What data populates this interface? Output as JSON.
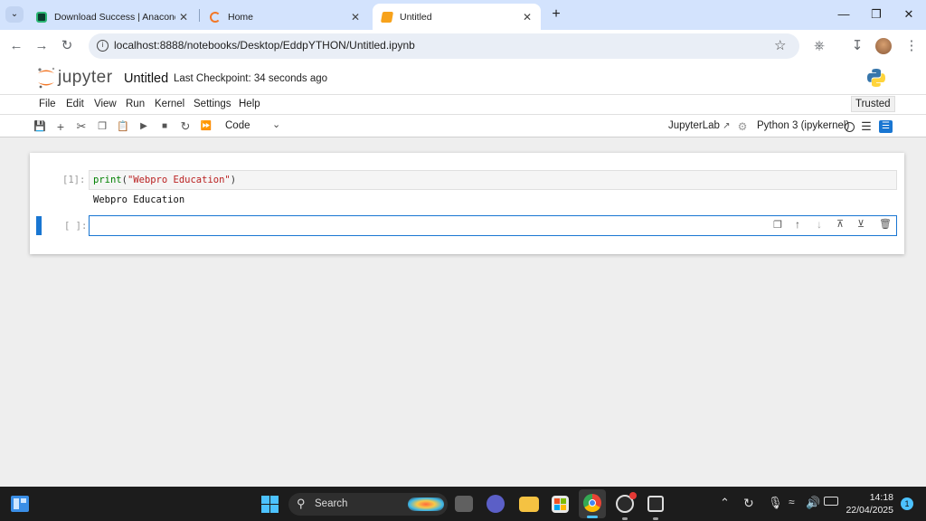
{
  "browser": {
    "tabs": [
      {
        "title": "Download Success | Anaconda",
        "active": false
      },
      {
        "title": "Home",
        "active": false
      },
      {
        "title": "Untitled",
        "active": true
      }
    ],
    "url": "localhost:8888/notebooks/Desktop/EddpYTHON/Untitled.ipynb"
  },
  "jupyter": {
    "logo_text": "jupyter",
    "notebook_title": "Untitled",
    "checkpoint": "Last Checkpoint: 34 seconds ago",
    "menu": [
      "File",
      "Edit",
      "View",
      "Run",
      "Kernel",
      "Settings",
      "Help"
    ],
    "trusted": "Trusted",
    "cell_type": "Code",
    "jupyterlab_link": "JupyterLab",
    "kernel": "Python 3 (ipykernel)",
    "cells": [
      {
        "prompt": "[1]:",
        "code_func": "print",
        "code_open": "(",
        "code_string": "\"Webpro Education\"",
        "code_close": ")",
        "output": "Webpro Education"
      },
      {
        "prompt": "[ ]:",
        "code": ""
      }
    ]
  },
  "taskbar": {
    "search_label": "Search",
    "time": "14:18",
    "date": "22/04/2025",
    "notification_count": "1"
  }
}
